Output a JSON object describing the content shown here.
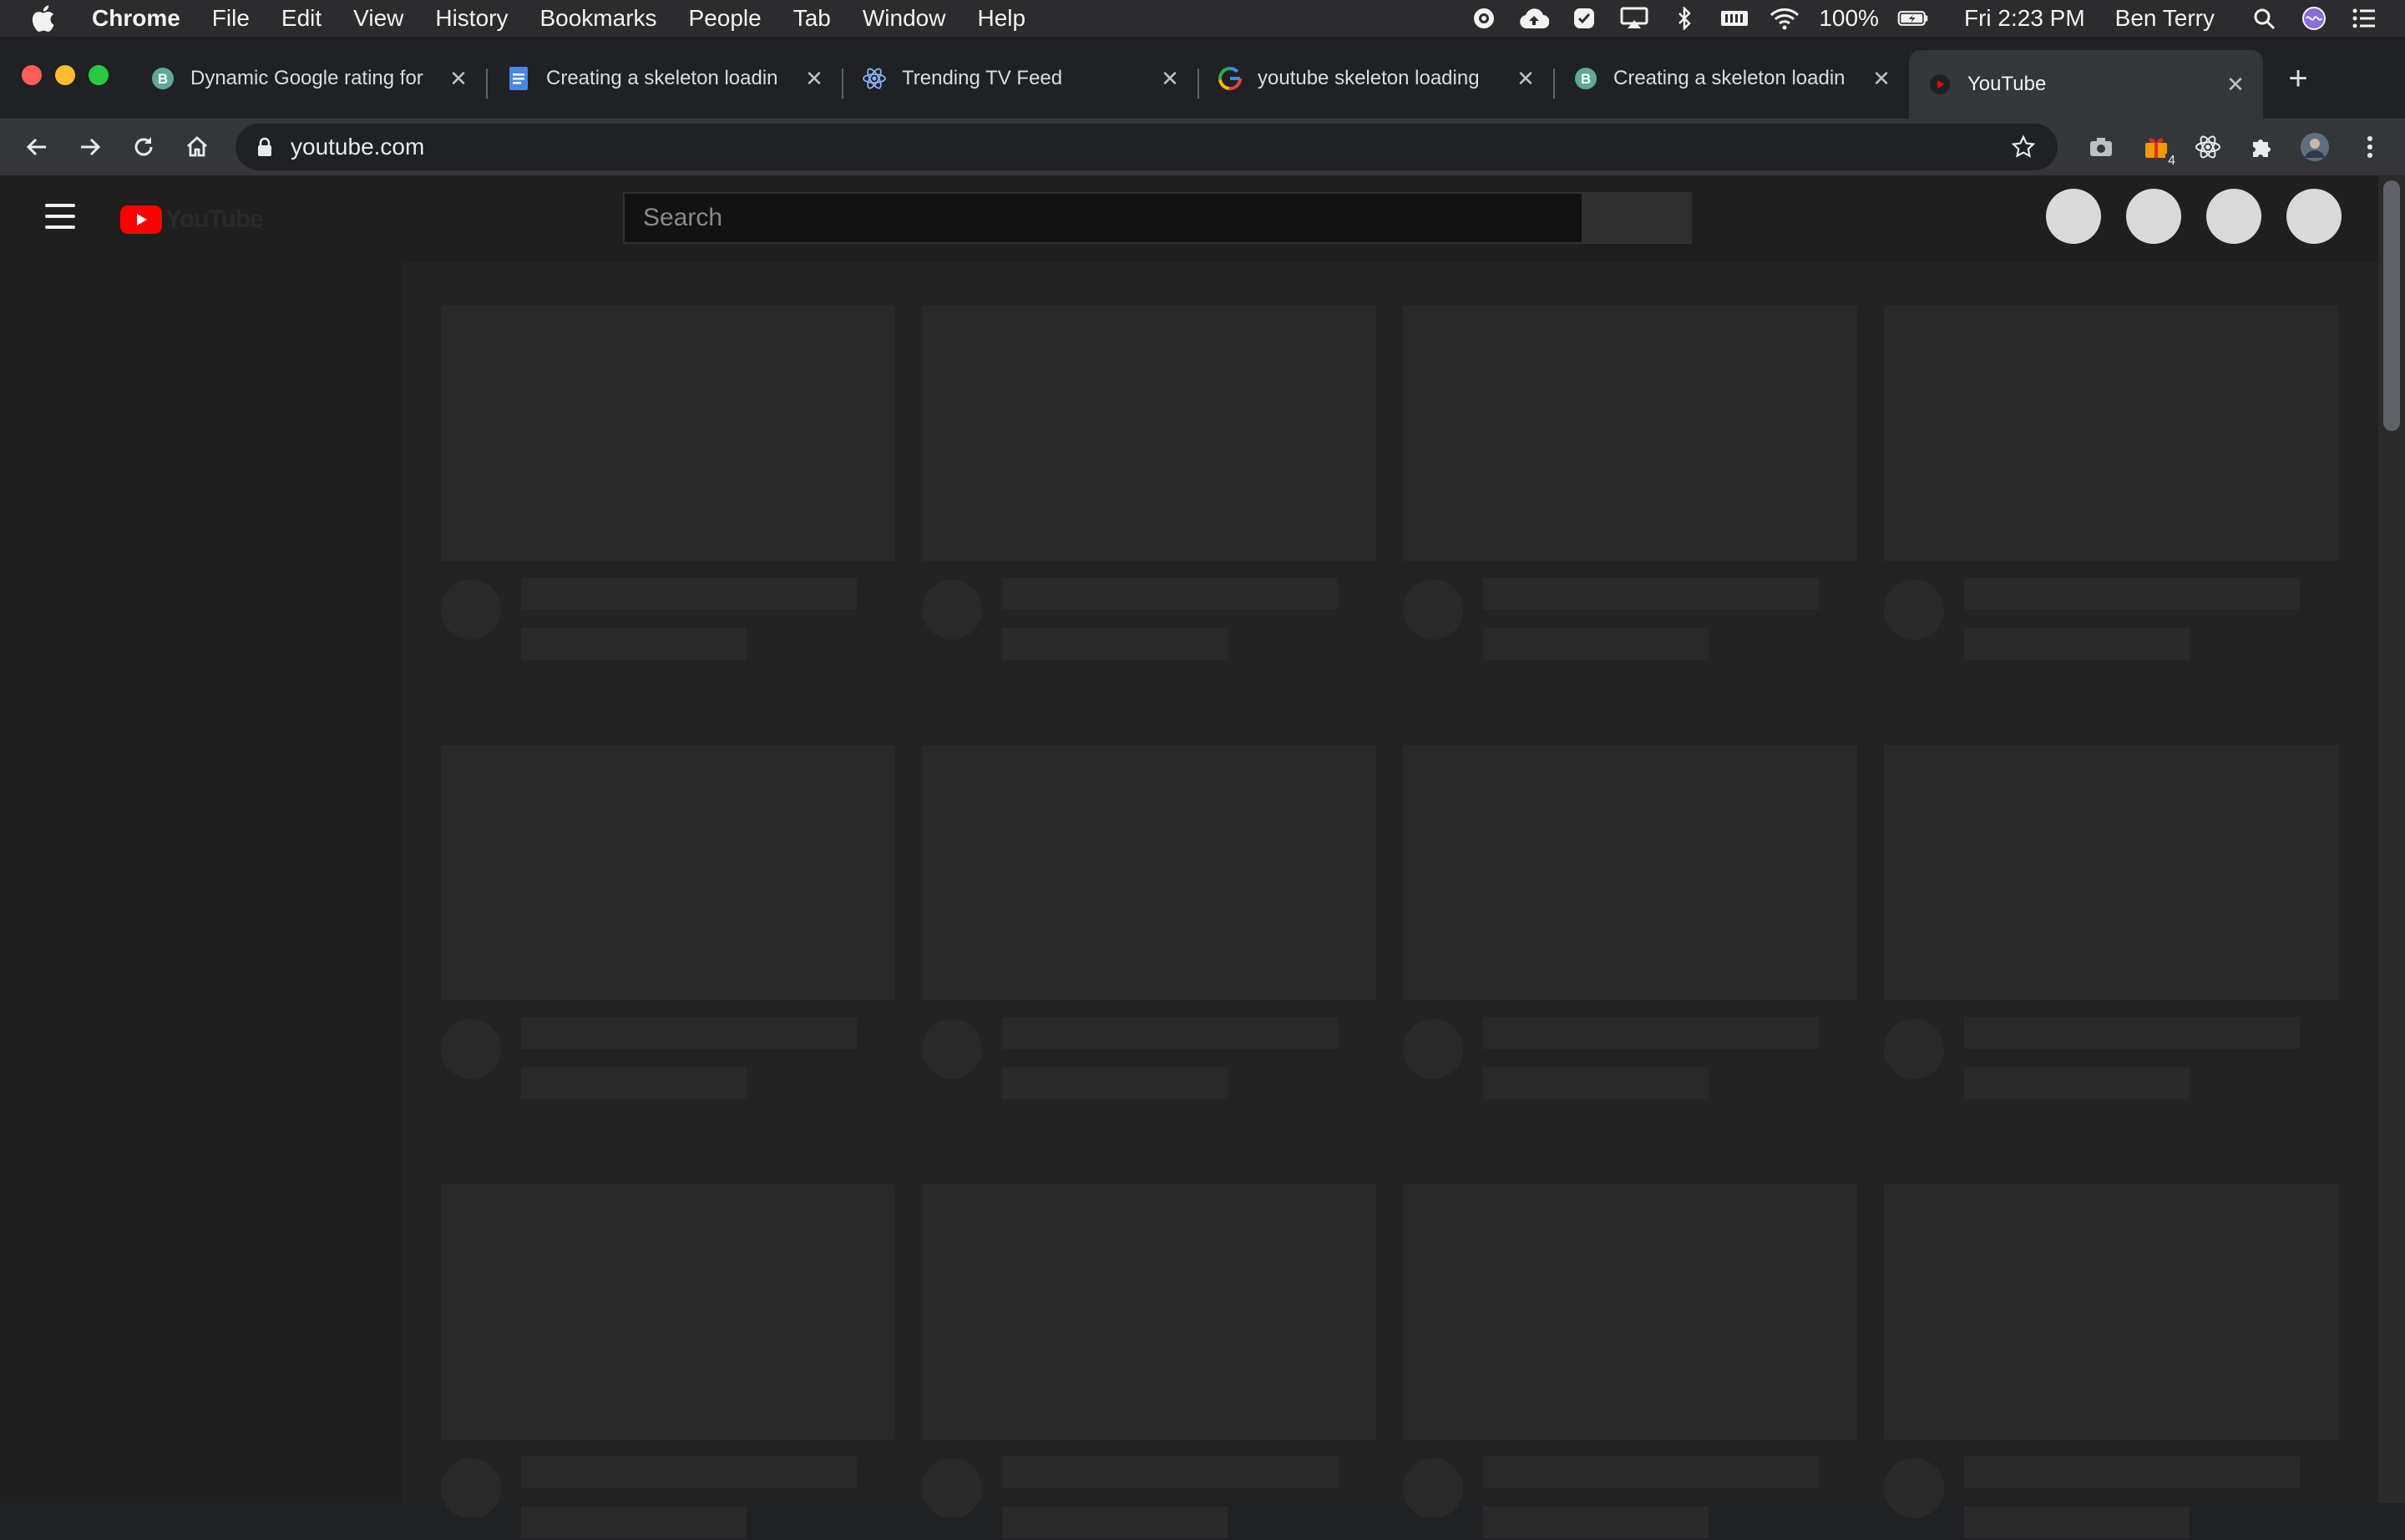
{
  "menubar": {
    "app_name": "Chrome",
    "items": [
      "File",
      "Edit",
      "View",
      "History",
      "Bookmarks",
      "People",
      "Tab",
      "Window",
      "Help"
    ],
    "battery": "100%",
    "clock": "Fri 2:23 PM",
    "user": "Ben Terry"
  },
  "tabs": [
    {
      "title": "Dynamic Google rating for",
      "favicon": "b-circle-icon"
    },
    {
      "title": "Creating a skeleton loadin",
      "favicon": "docs-icon"
    },
    {
      "title": "Trending TV Feed",
      "favicon": "react-icon"
    },
    {
      "title": "youtube skeleton loading",
      "favicon": "google-icon"
    },
    {
      "title": "Creating a skeleton loadin",
      "favicon": "b-circle-icon"
    },
    {
      "title": "YouTube",
      "favicon": "youtube-icon",
      "active": true
    }
  ],
  "toolbar": {
    "url": "youtube.com",
    "extension_badge": "4"
  },
  "youtube": {
    "search_placeholder": "Search",
    "logo_text": "YouTube"
  },
  "feed": {
    "rows": 3,
    "columns": 4,
    "state": "loading-skeleton"
  },
  "colors": {
    "youtube_red": "#ff0000",
    "skeleton": "#2a2a2a",
    "page_bg": "#1f1f1f"
  }
}
